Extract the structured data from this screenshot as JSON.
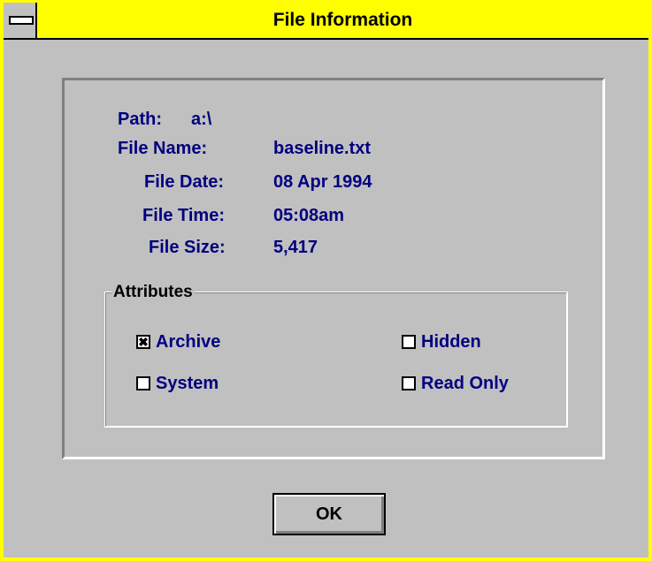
{
  "window": {
    "title": "File Information"
  },
  "info": {
    "path_label": "Path:",
    "path_value": "a:\\",
    "name_label": "File Name:",
    "name_value": "baseline.txt",
    "date_label": "File Date:",
    "date_value": "08 Apr 1994",
    "time_label": "File Time:",
    "time_value": "05:08am",
    "size_label": "File Size:",
    "size_value": "5,417"
  },
  "attributes": {
    "title": "Attributes",
    "archive": {
      "label": "Archive",
      "checked": true,
      "mark": "✖"
    },
    "hidden": {
      "label": "Hidden",
      "checked": false,
      "mark": ""
    },
    "system": {
      "label": "System",
      "checked": false,
      "mark": ""
    },
    "readonly": {
      "label": "Read Only",
      "checked": false,
      "mark": ""
    }
  },
  "buttons": {
    "ok_label": "OK"
  },
  "colors": {
    "title_bar": "#ffff00",
    "text": "#000080",
    "face": "#c0c0c0"
  },
  "icons": {
    "system_menu": "system-menu-icon"
  }
}
